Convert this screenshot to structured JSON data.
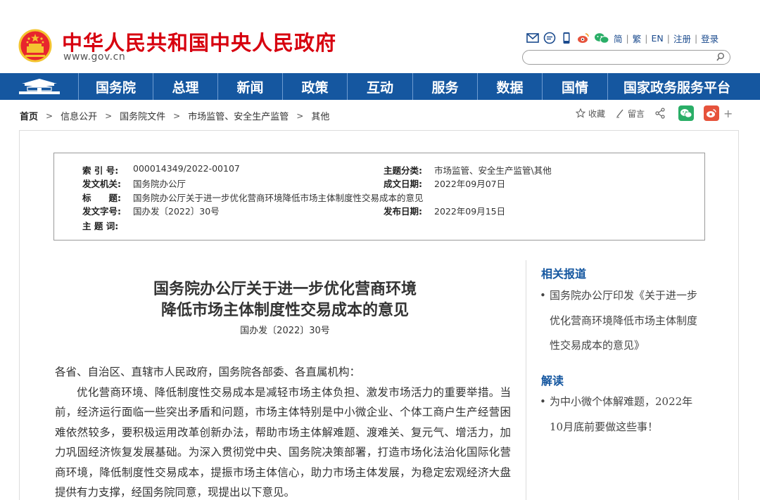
{
  "header": {
    "site_title": "中华人民共和国中央人民政府",
    "site_url": "www.gov.cn",
    "links": [
      "简",
      "繁",
      "EN",
      "注册",
      "登录"
    ],
    "icons": [
      "mail-icon",
      "chat-icon",
      "mobile-icon",
      "weibo-icon",
      "wechat-icon"
    ]
  },
  "nav": {
    "items": [
      "国务院",
      "总理",
      "新闻",
      "政策",
      "互动",
      "服务",
      "数据",
      "国情",
      "国家政务服务平台"
    ]
  },
  "breadcrumb": {
    "items": [
      "首页",
      "信息公开",
      "国务院文件",
      "市场监管、安全生产监管",
      "其他"
    ]
  },
  "tools": {
    "favorite": "收藏",
    "comment": "留言"
  },
  "info": {
    "index_label": "索 引 号:",
    "index_value": "000014349/2022-00107",
    "subject_label": "主题分类:",
    "subject_value": "市场监管、安全生产监管\\其他",
    "issuer_label": "发文机关:",
    "issuer_value": "国务院办公厅",
    "written_label": "成文日期:",
    "written_value": "2022年09月07日",
    "title_label": "标　　题:",
    "title_value": "国务院办公厅关于进一步优化营商环境降低市场主体制度性交易成本的意见",
    "docno_label": "发文字号:",
    "docno_value": "国办发〔2022〕30号",
    "published_label": "发布日期:",
    "published_value": "2022年09月15日",
    "keywords_label": "主 题 词:",
    "keywords_value": ""
  },
  "article": {
    "title_line1": "国务院办公厅关于进一步优化营商环境",
    "title_line2": "降低市场主体制度性交易成本的意见",
    "doc_number": "国办发〔2022〕30号",
    "salutation": "各省、自治区、直辖市人民政府，国务院各部委、各直属机构：",
    "paragraph1": "优化营商环境、降低制度性交易成本是减轻市场主体负担、激发市场活力的重要举措。当前，经济运行面临一些突出矛盾和问题，市场主体特别是中小微企业、个体工商户生产经营困难依然较多，要积极运用改革创新办法，帮助市场主体解难题、渡难关、复元气、增活力，加力巩固经济恢复发展基础。为深入贯彻党中央、国务院决策部署，打造市场化法治化国际化营商环境，降低制度性交易成本，提振市场主体信心，助力市场主体发展，为稳定宏观经济大盘提供有力支撑，经国务院同意，现提出以下意见。"
  },
  "sidebar": {
    "related_heading": "相关报道",
    "related_items": [
      "国务院办公厅印发《关于进一步优化营商环境降低市场主体制度性交易成本的意见》"
    ],
    "interpret_heading": "解读",
    "interpret_items": [
      "为中小微个体解难题，2022年10月底前要做这些事！"
    ]
  },
  "colors": {
    "brand_red": "#d7000f",
    "nav_blue": "#1557a0",
    "wechat_green": "#2aae67",
    "weibo_red": "#e6533c"
  }
}
